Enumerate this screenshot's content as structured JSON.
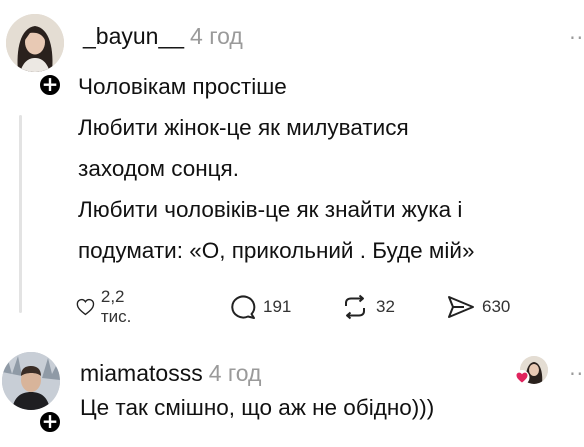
{
  "post": {
    "username": "_bayun__",
    "time": "4 год",
    "more_icon": "ellipsis-icon",
    "lines": [
      "Чоловікам простіше",
      "Любити жінок-це як милуватися",
      "заходом сонця.",
      "Любити чоловіків-це як знайти жука і",
      "подумати: «О, прикольний . Буде мій»"
    ],
    "likes": "2,2 тис.",
    "replies": "191",
    "reposts": "32",
    "shares": "630"
  },
  "reply": {
    "username": "miamatosss",
    "time": "4 год",
    "text": "Це так смішно, що аж не обідно)))"
  },
  "icons": {
    "follow": "plus-icon",
    "like": "heart-icon",
    "reply": "speech-bubble-icon",
    "repost": "repost-icon",
    "share": "send-icon"
  },
  "colors": {
    "text": "#111111",
    "muted": "#9a9a9a",
    "heart_badge": "#e0245e"
  }
}
